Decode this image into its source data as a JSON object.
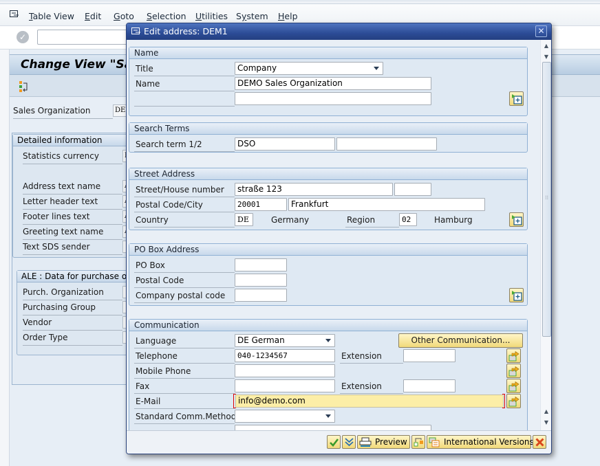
{
  "menubar": {
    "items": [
      {
        "label": "Table View",
        "mnemonic": "T"
      },
      {
        "label": "Edit",
        "mnemonic": "E"
      },
      {
        "label": "Goto",
        "mnemonic": "G"
      },
      {
        "label": "Selection",
        "mnemonic": "S"
      },
      {
        "label": "Utilities",
        "mnemonic": "U"
      },
      {
        "label": "System",
        "mnemonic": "y"
      },
      {
        "label": "Help",
        "mnemonic": "H"
      }
    ]
  },
  "toolbar": {
    "command_field_value": ""
  },
  "page": {
    "title": "Change View \"Sales Organization\": Details",
    "sales_org_label": "Sales Organization",
    "sales_org_value": "DEMO",
    "detailed_info": {
      "title": "Detailed information",
      "fields": [
        {
          "label": "Statistics currency",
          "value": "EUR"
        },
        {
          "label": "Address text name",
          "value": "ADRS_SENDER"
        },
        {
          "label": "Letter header text",
          "value": "ADRS_HEADER"
        },
        {
          "label": "Footer lines text",
          "value": "ADRS_FOOTER"
        },
        {
          "label": "Greeting text name",
          "value": "ADRS_SIGNATURE"
        },
        {
          "label": "Text SDS sender",
          "value": ""
        }
      ]
    },
    "ale": {
      "title": "ALE : Data for purchase order",
      "fields": [
        {
          "label": "Purch. Organization",
          "value": ""
        },
        {
          "label": "Purchasing Group",
          "value": ""
        },
        {
          "label": "Vendor",
          "value": ""
        },
        {
          "label": "Order Type",
          "value": ""
        }
      ]
    }
  },
  "dialog": {
    "title": "Edit address:  DEM1",
    "name_group": {
      "title": "Name",
      "title_label": "Title",
      "title_value": "Company",
      "name_label": "Name",
      "name_value": "DEMO Sales Organization",
      "name2_value": ""
    },
    "search_group": {
      "title": "Search Terms",
      "label": "Search term 1/2",
      "term1": "DSO",
      "term2": ""
    },
    "street_group": {
      "title": "Street Address",
      "street_label": "Street/House number",
      "street_value": "straße 123",
      "house_number": "",
      "postal_city_label": "Postal Code/City",
      "postal_code": "20001",
      "city": "Frankfurt",
      "country_label": "Country",
      "country_code": "DE",
      "country_name": "Germany",
      "region_label": "Region",
      "region_code": "02",
      "region_name": "Hamburg"
    },
    "pobox_group": {
      "title": "PO Box Address",
      "pobox_label": "PO Box",
      "pobox_value": "",
      "postal_code_label": "Postal Code",
      "postal_code_value": "",
      "company_postal_label": "Company postal code",
      "company_postal_value": ""
    },
    "comm_group": {
      "title": "Communication",
      "language_label": "Language",
      "language_value": "DE German",
      "other_comm_button": "Other Communication...",
      "telephone_label": "Telephone",
      "telephone_value": "040-1234567",
      "tel_extension_label": "Extension",
      "tel_extension_value": "",
      "mobile_label": "Mobile Phone",
      "mobile_value": "",
      "fax_label": "Fax",
      "fax_value": "",
      "fax_extension_label": "Extension",
      "fax_extension_value": "",
      "email_label": "E-Mail",
      "email_value": "info@demo.com",
      "std_comm_label": "Standard Comm.Method",
      "std_comm_value": ""
    },
    "footer": {
      "preview_label": "Preview",
      "intl_versions_label": "International Versions"
    }
  }
}
